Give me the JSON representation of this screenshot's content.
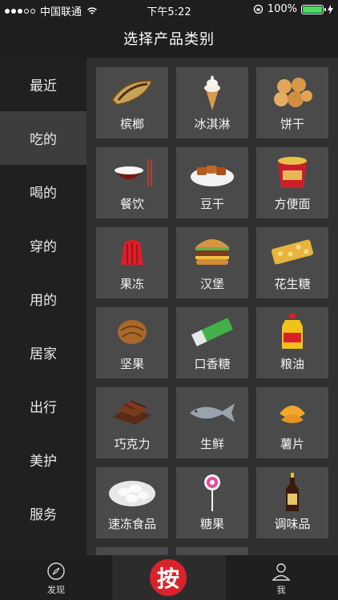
{
  "status": {
    "carrier": "中国联通",
    "time": "下午5:22",
    "battery": "100%",
    "battery_fill": 1.0
  },
  "nav": {
    "title": "选择产品类别"
  },
  "sidebar": {
    "items": [
      {
        "label": "最近"
      },
      {
        "label": "吃的"
      },
      {
        "label": "喝的"
      },
      {
        "label": "穿的"
      },
      {
        "label": "用的"
      },
      {
        "label": "居家"
      },
      {
        "label": "出行"
      },
      {
        "label": "美护"
      },
      {
        "label": "服务"
      }
    ],
    "active": "吃的"
  },
  "grid": {
    "items": [
      {
        "label": "槟榔",
        "icon": "betel-nut-icon"
      },
      {
        "label": "冰淇淋",
        "icon": "ice-cream-icon"
      },
      {
        "label": "饼干",
        "icon": "cookies-icon"
      },
      {
        "label": "餐饮",
        "icon": "rice-bowl-icon"
      },
      {
        "label": "豆干",
        "icon": "dried-tofu-icon"
      },
      {
        "label": "方便面",
        "icon": "instant-noodles-icon"
      },
      {
        "label": "果冻",
        "icon": "jelly-icon"
      },
      {
        "label": "汉堡",
        "icon": "burger-icon"
      },
      {
        "label": "花生糖",
        "icon": "peanut-candy-icon"
      },
      {
        "label": "坚果",
        "icon": "walnut-icon"
      },
      {
        "label": "口香糖",
        "icon": "chewing-gum-icon"
      },
      {
        "label": "粮油",
        "icon": "cooking-oil-icon"
      },
      {
        "label": "巧克力",
        "icon": "chocolate-icon"
      },
      {
        "label": "生鲜",
        "icon": "fish-icon"
      },
      {
        "label": "薯片",
        "icon": "potato-chips-icon"
      },
      {
        "label": "速冻食品",
        "icon": "dumplings-icon"
      },
      {
        "label": "糖果",
        "icon": "lollipop-icon"
      },
      {
        "label": "调味品",
        "icon": "seasoning-bottle-icon"
      }
    ]
  },
  "tabbar": {
    "discover": "发现",
    "press": "按",
    "me": "我"
  }
}
